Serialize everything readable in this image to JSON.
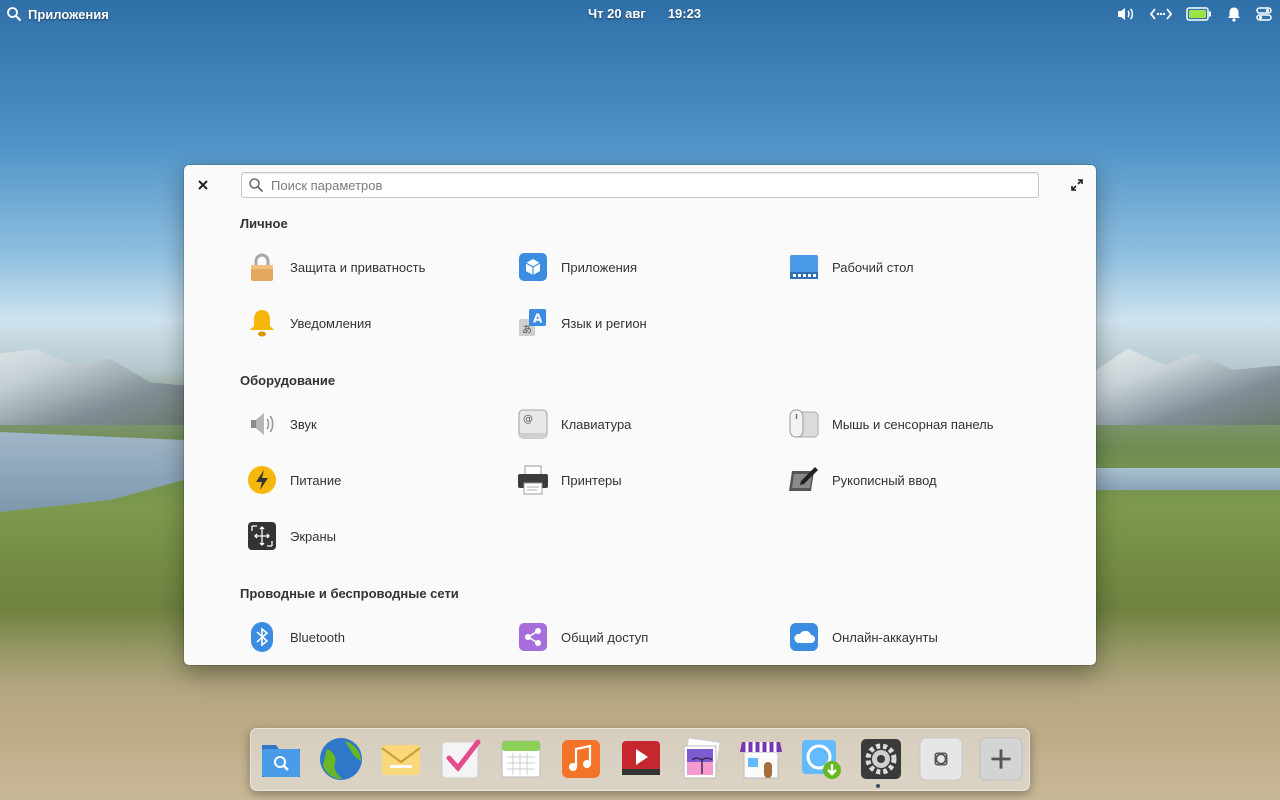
{
  "top_panel": {
    "apps_label": "Приложения",
    "date": "Чт 20 авг",
    "time": "19:23",
    "indicators": [
      "volume-icon",
      "network-icon",
      "battery-icon",
      "notifications-icon",
      "session-icon"
    ]
  },
  "window": {
    "search_placeholder": "Поиск параметров",
    "sections": [
      {
        "title": "Личное",
        "items": [
          {
            "label": "Защита и приватность",
            "icon": "lock-icon"
          },
          {
            "label": "Приложения",
            "icon": "applications-icon"
          },
          {
            "label": "Рабочий стол",
            "icon": "desktop-icon"
          },
          {
            "label": "Уведомления",
            "icon": "bell-icon"
          },
          {
            "label": "Язык и регион",
            "icon": "language-icon"
          }
        ]
      },
      {
        "title": "Оборудование",
        "items": [
          {
            "label": "Звук",
            "icon": "speaker-icon"
          },
          {
            "label": "Клавиатура",
            "icon": "keyboard-icon"
          },
          {
            "label": "Мышь и сенсорная панель",
            "icon": "mouse-icon"
          },
          {
            "label": "Питание",
            "icon": "power-icon"
          },
          {
            "label": "Принтеры",
            "icon": "printer-icon"
          },
          {
            "label": "Рукописный ввод",
            "icon": "tablet-icon"
          },
          {
            "label": "Экраны",
            "icon": "display-icon"
          }
        ]
      },
      {
        "title": "Проводные и беспроводные сети",
        "items": [
          {
            "label": "Bluetooth",
            "icon": "bluetooth-icon"
          },
          {
            "label": "Общий доступ",
            "icon": "sharing-icon"
          },
          {
            "label": "Онлайн-аккаунты",
            "icon": "cloud-icon"
          }
        ]
      }
    ]
  },
  "dock": {
    "apps": [
      "files-icon",
      "web-browser-icon",
      "mail-icon",
      "tasks-icon",
      "calendar-icon",
      "music-icon",
      "videos-icon",
      "photos-icon",
      "appcenter-icon",
      "installer-icon",
      "system-settings-icon",
      "screenshot-icon",
      "add-icon"
    ]
  }
}
